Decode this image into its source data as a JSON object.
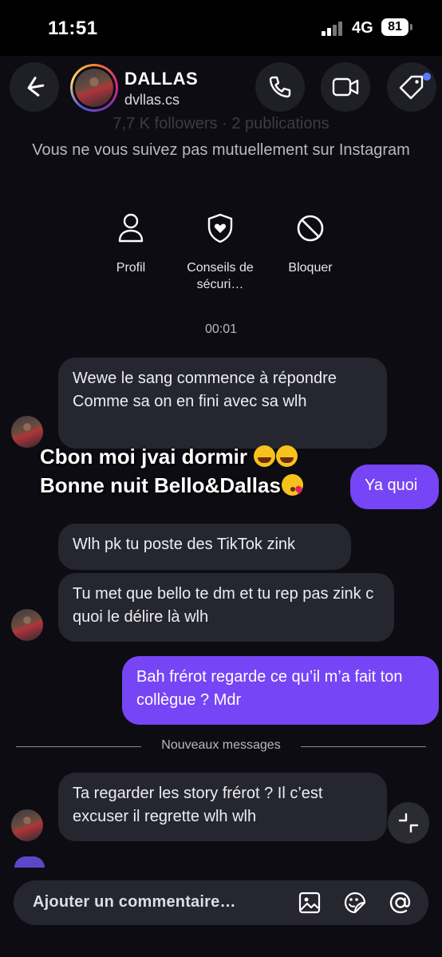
{
  "status_bar": {
    "time": "11:51",
    "network": "4G",
    "battery": "81"
  },
  "header": {
    "back_icon": "chevron-left-icon",
    "name": "DALLAS",
    "handle": "dvllas.cs",
    "actions": [
      "phone-icon",
      "video-icon",
      "tag-icon"
    ]
  },
  "profile": {
    "followers_line": "7,7 K followers · 2 publications",
    "mutual_text": "Vous ne vous suivez pas mutuellement sur Instagram",
    "actions": [
      {
        "label": "Profil",
        "icon": "user-icon"
      },
      {
        "label": "Conseils de sécuri…",
        "icon": "shield-heart-icon"
      },
      {
        "label": "Bloquer",
        "icon": "block-icon"
      }
    ]
  },
  "timestamp": "00:01",
  "overlay_text": {
    "line1": "Cbon moi jvai dormir",
    "line2": "Bonne nuit Bello&Dallas"
  },
  "messages": [
    {
      "from": "them",
      "text": "Wewe le sang commence à répondre Comme sa on en fini avec sa wlh"
    },
    {
      "from": "me",
      "text": "Ya quoi"
    },
    {
      "from": "them",
      "text": "Wlh pk tu poste des TikTok zink"
    },
    {
      "from": "them",
      "text": "Tu met que bello te dm et tu rep pas zink c quoi le délire là wlh"
    },
    {
      "from": "me",
      "text": "Bah frérot regarde ce qu’il m’a fait ton collègue ? Mdr"
    },
    {
      "from": "them",
      "text": "Ta regarder les story frérot ? Il c’est excuser il regrette wlh wlh"
    }
  ],
  "divider_label": "Nouveaux messages",
  "composer": {
    "placeholder": "Ajouter un commentaire…",
    "icons": [
      "image-icon",
      "sticker-icon",
      "mention-icon"
    ]
  },
  "colors": {
    "outgoing_bubble": "#7645f6",
    "incoming_bubble": "#262630",
    "background": "#0c0c12"
  }
}
